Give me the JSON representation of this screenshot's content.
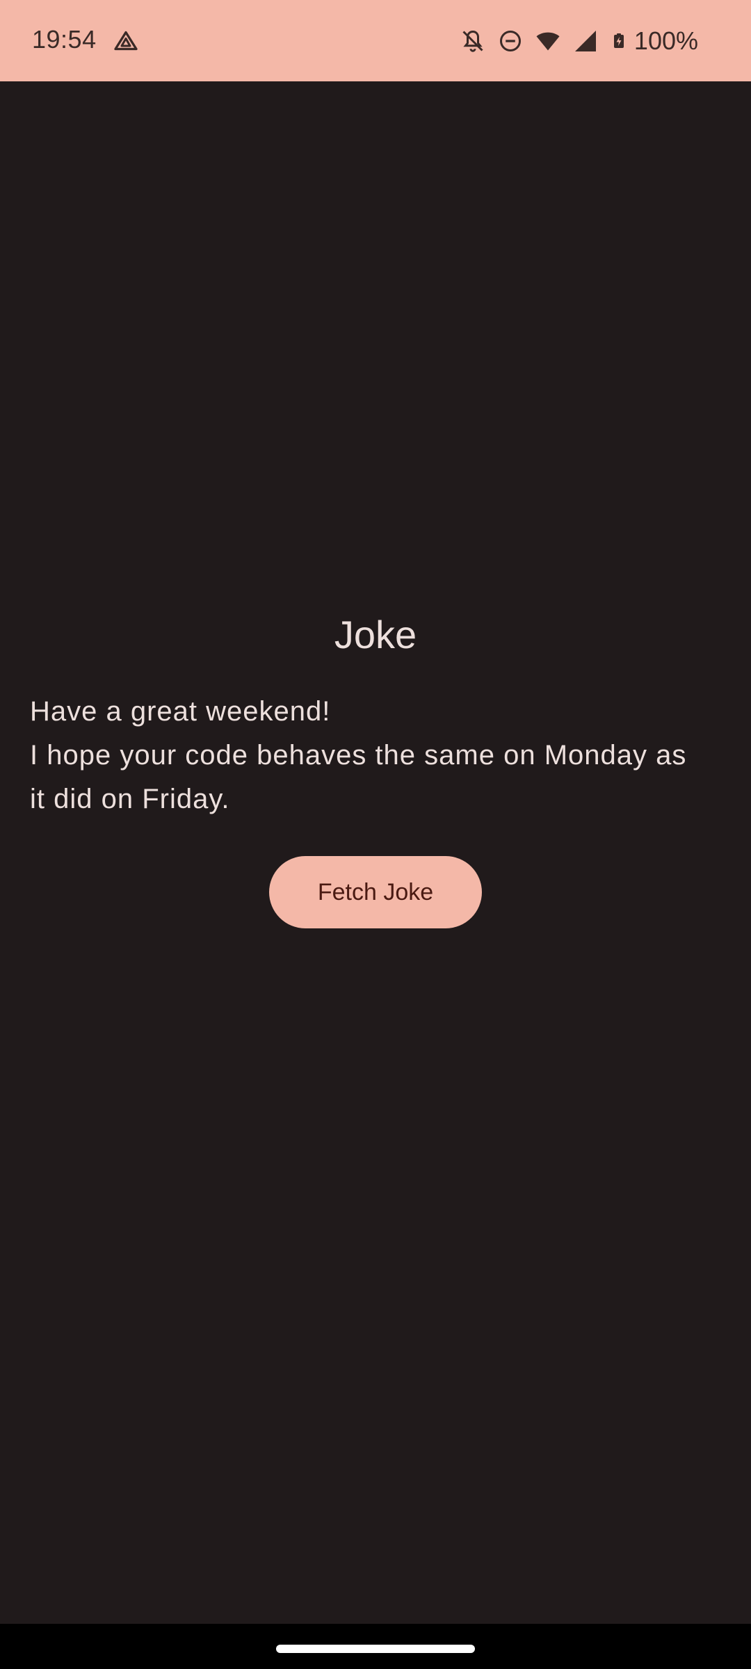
{
  "status_bar": {
    "time": "19:54",
    "battery_text": "100%",
    "icons": [
      "app-notification-icon",
      "bell-off-icon",
      "do-not-disturb-icon",
      "wifi-icon",
      "cellular-signal-icon",
      "battery-charging-icon"
    ],
    "background_color": "#f4b8a8"
  },
  "screen": {
    "title": "Joke",
    "joke_lines": [
      "Have a great weekend!",
      "I hope your code behaves the same on Monday as",
      "it did on Friday."
    ],
    "fetch_button_label": "Fetch Joke",
    "background_color": "#201a1b",
    "accent_color": "#f4b8a8"
  }
}
